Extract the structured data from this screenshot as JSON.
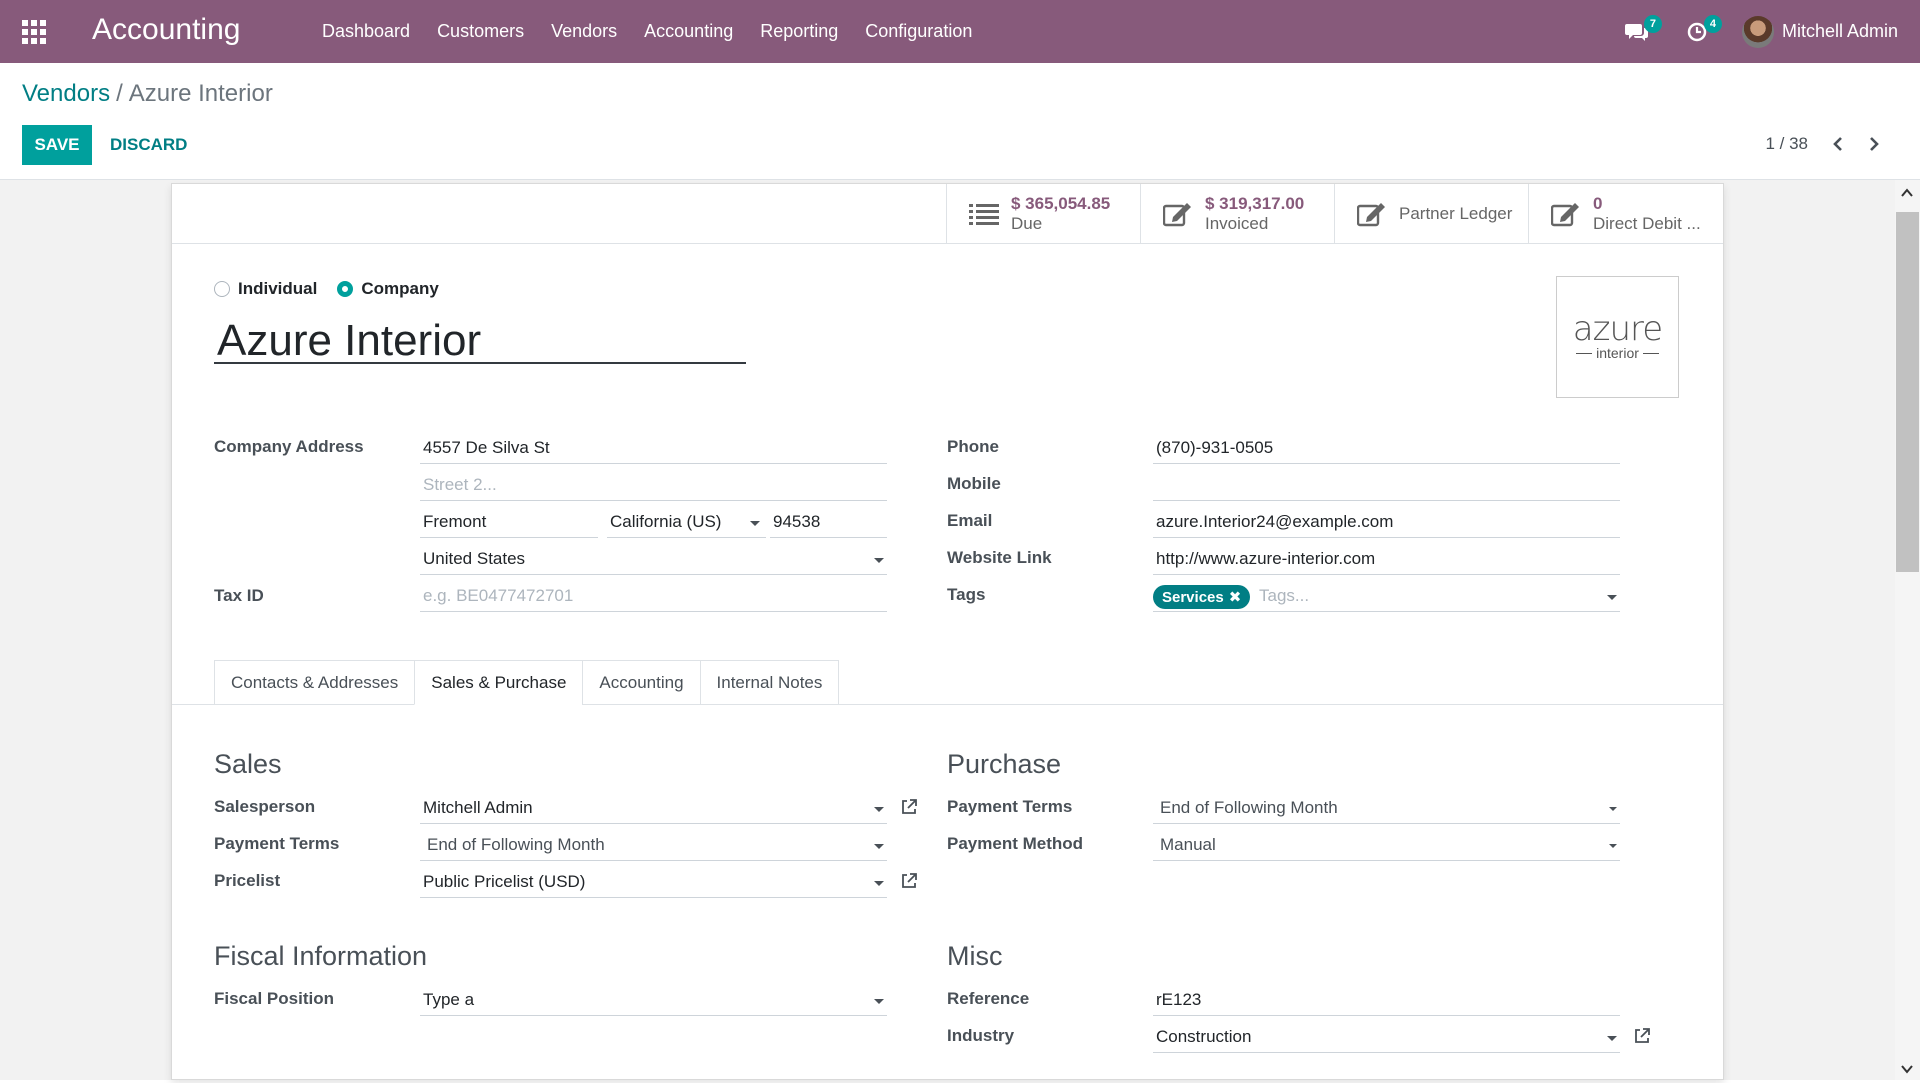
{
  "navbar": {
    "app_name": "Accounting",
    "menu": [
      "Dashboard",
      "Customers",
      "Vendors",
      "Accounting",
      "Reporting",
      "Configuration"
    ],
    "messages_count": "7",
    "activities_count": "4",
    "user_name": "Mitchell Admin",
    "bg_color": "#875a7b"
  },
  "breadcrumb": {
    "parent": "Vendors",
    "separator": "/",
    "current": "Azure Interior"
  },
  "actions": {
    "save": "SAVE",
    "discard": "DISCARD"
  },
  "pager": {
    "value": "1 / 38"
  },
  "smart_buttons": {
    "due_value": "$ 365,054.85",
    "due_label": "Due",
    "invoiced_value": "$ 319,317.00",
    "invoiced_label": "Invoiced",
    "ledger_label": "Partner Ledger",
    "debit_value": "0",
    "debit_label": "Direct Debit ..."
  },
  "company_type": {
    "individual": "Individual",
    "company": "Company",
    "selected": "Company"
  },
  "partner": {
    "name": "Azure Interior",
    "logo_word": "azure",
    "logo_sub": "interior"
  },
  "address": {
    "label": "Company Address",
    "street": "4557 De Silva St",
    "street2_placeholder": "Street 2...",
    "city": "Fremont",
    "state": "California (US)",
    "zip": "94538",
    "country": "United States"
  },
  "tax": {
    "label": "Tax ID",
    "placeholder": "e.g. BE0477472701"
  },
  "contact": {
    "phone_label": "Phone",
    "phone": "(870)-931-0505",
    "mobile_label": "Mobile",
    "mobile": "",
    "email_label": "Email",
    "email": "azure.Interior24@example.com",
    "website_label": "Website Link",
    "website": "http://www.azure-interior.com",
    "tags_label": "Tags",
    "tag": "Services",
    "tags_placeholder": "Tags..."
  },
  "tabs": [
    "Contacts & Addresses",
    "Sales & Purchase",
    "Accounting",
    "Internal Notes"
  ],
  "active_tab": "Sales & Purchase",
  "sales": {
    "title": "Sales",
    "salesperson_label": "Salesperson",
    "salesperson": "Mitchell Admin",
    "payment_terms_label": "Payment Terms",
    "payment_terms": "End of Following Month",
    "pricelist_label": "Pricelist",
    "pricelist": "Public Pricelist (USD)"
  },
  "purchase": {
    "title": "Purchase",
    "payment_terms_label": "Payment Terms",
    "payment_terms": "End of Following Month",
    "payment_method_label": "Payment Method",
    "payment_method": "Manual"
  },
  "fiscal": {
    "title": "Fiscal Information",
    "position_label": "Fiscal Position",
    "position": "Type a"
  },
  "misc": {
    "title": "Misc",
    "reference_label": "Reference",
    "reference": "rE123",
    "industry_label": "Industry",
    "industry": "Construction"
  }
}
